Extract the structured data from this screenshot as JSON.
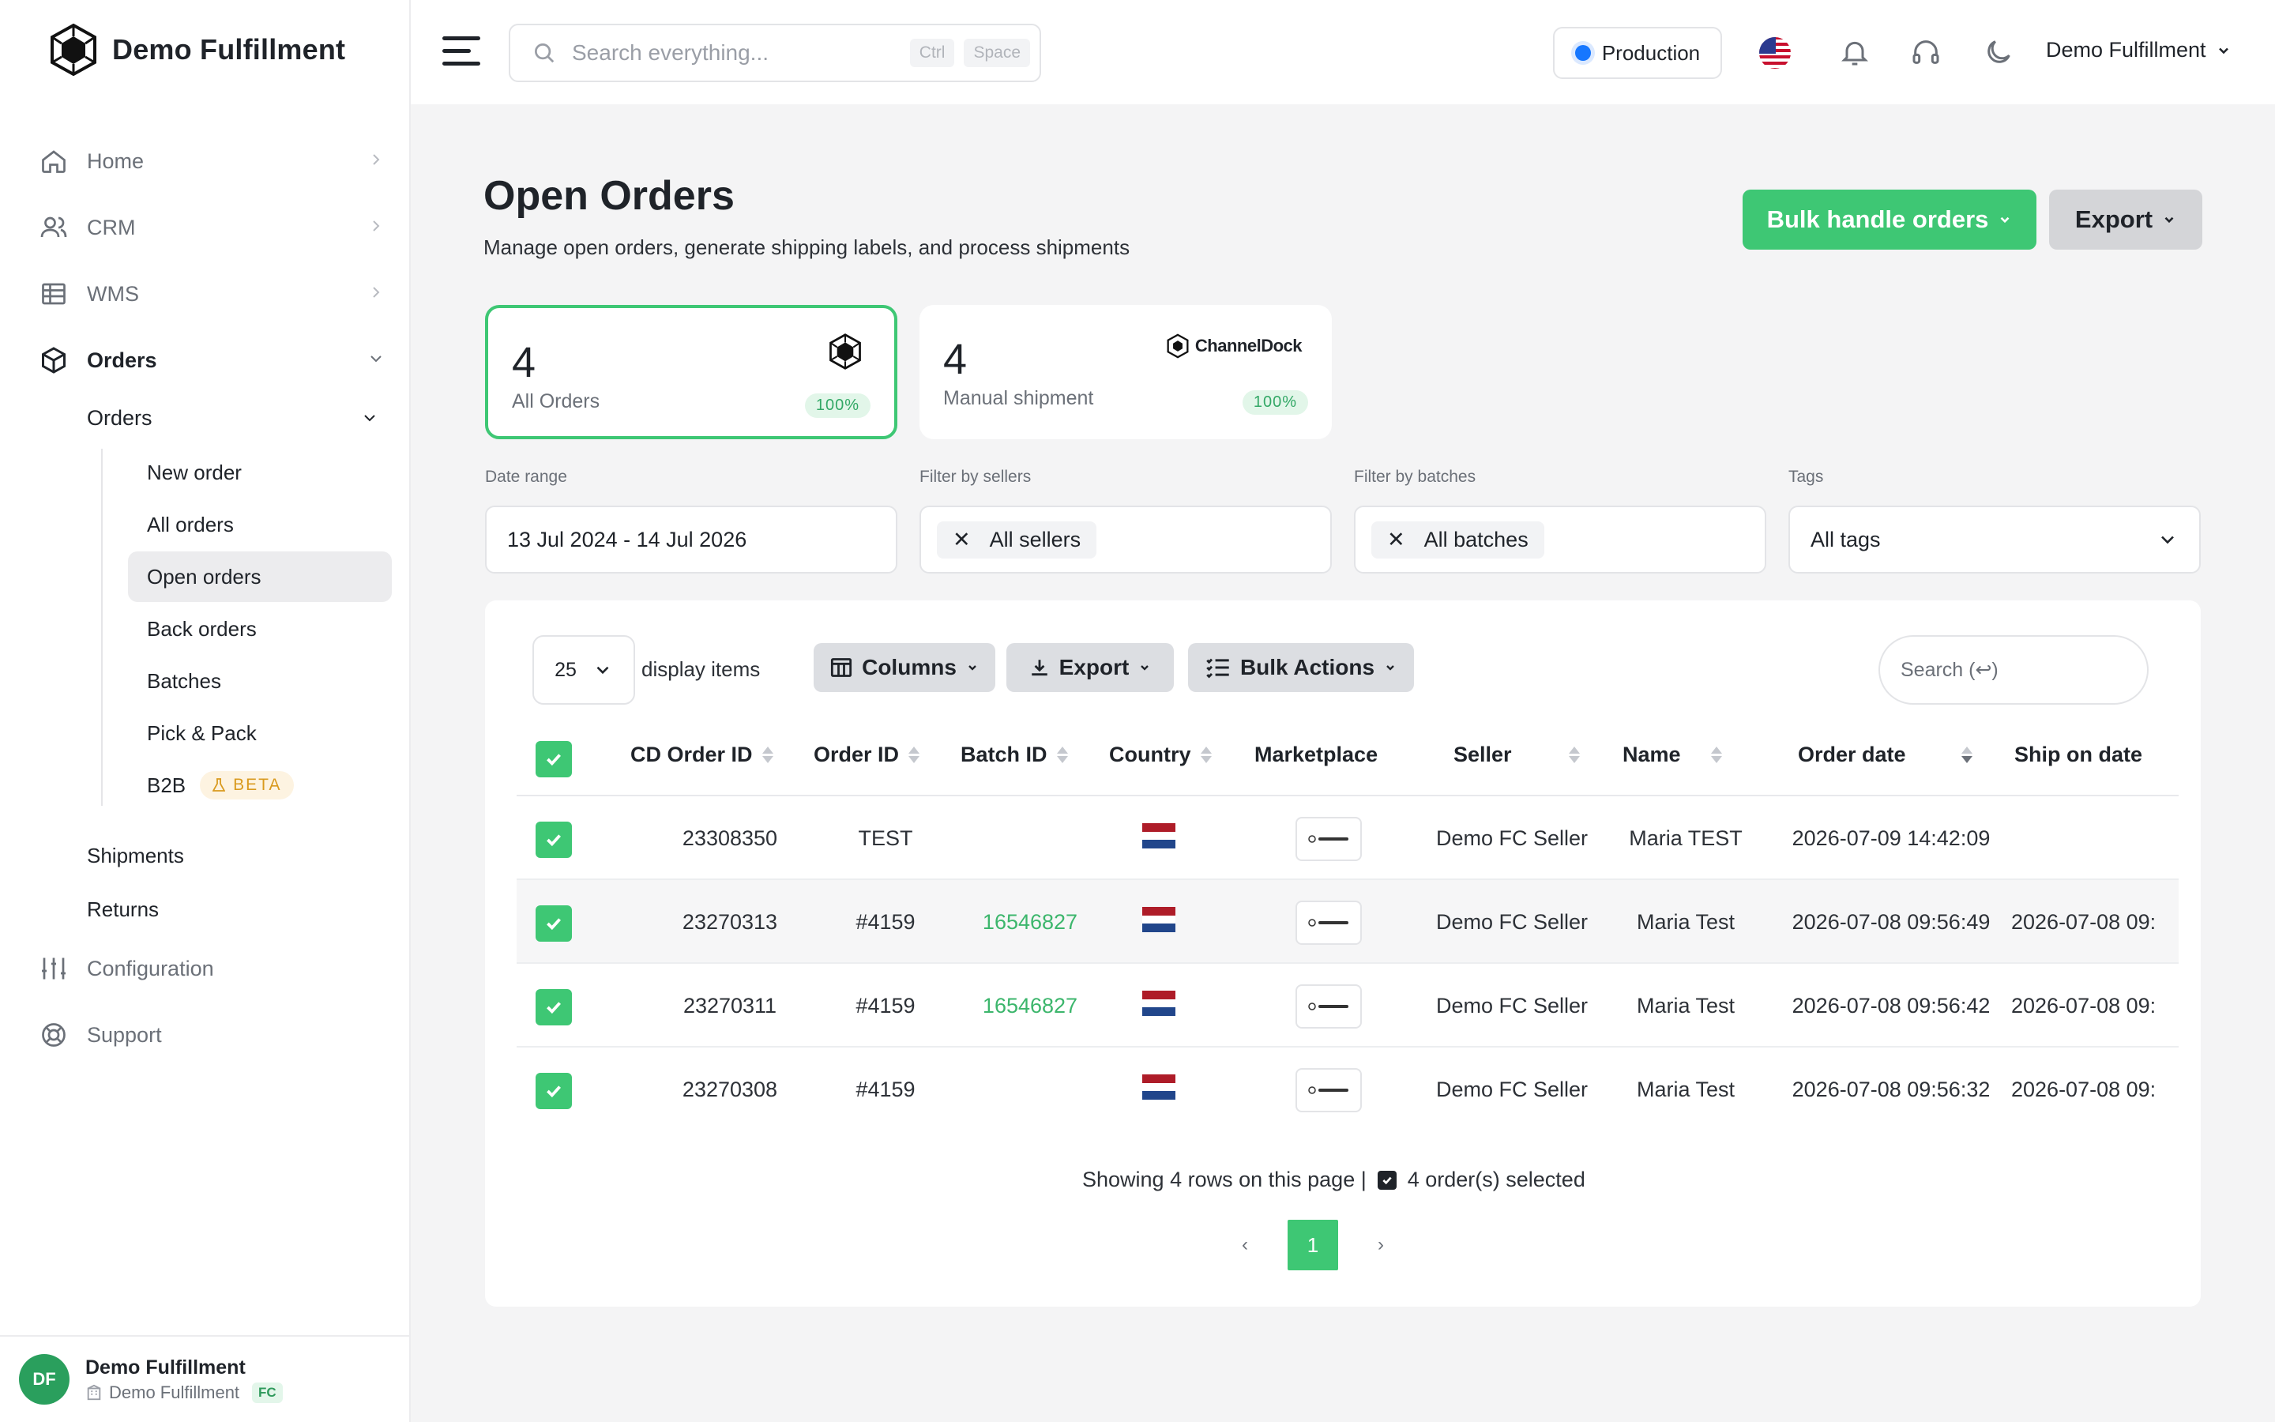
{
  "brand": {
    "name": "Demo Fulfillment"
  },
  "sidebar": {
    "items": [
      {
        "label": "Home",
        "icon": "home-icon"
      },
      {
        "label": "CRM",
        "icon": "users-icon"
      },
      {
        "label": "WMS",
        "icon": "table-icon"
      },
      {
        "label": "Orders",
        "icon": "box-icon"
      }
    ],
    "orders_sub": {
      "label": "Orders"
    },
    "orders_leaves": [
      "New order",
      "All orders",
      "Open orders",
      "Back orders",
      "Batches",
      "Pick & Pack",
      "B2B"
    ],
    "beta_label": "BETA",
    "shipments": "Shipments",
    "returns": "Returns",
    "configuration": "Configuration",
    "support": "Support",
    "footer": {
      "initials": "DF",
      "name": "Demo Fulfillment",
      "sub": "Demo Fulfillment",
      "badge": "FC"
    }
  },
  "topbar": {
    "search_placeholder": "Search everything...",
    "kbd1": "Ctrl",
    "kbd2": "Space",
    "environment": "Production",
    "user": "Demo Fulfillment"
  },
  "page": {
    "title": "Open Orders",
    "subtitle": "Manage open orders, generate shipping labels, and process shipments",
    "bulk_button": "Bulk handle orders",
    "export_button": "Export"
  },
  "cards": [
    {
      "count": "4",
      "label": "All Orders",
      "pct": "100%"
    },
    {
      "count": "4",
      "label": "Manual shipment",
      "pct": "100%",
      "brand": "ChannelDock"
    }
  ],
  "filters": {
    "date_label": "Date range",
    "date_value": "13 Jul 2024 - 14 Jul 2026",
    "sellers_label": "Filter by sellers",
    "sellers_value": "All sellers",
    "batches_label": "Filter by batches",
    "batches_value": "All batches",
    "tags_label": "Tags",
    "tags_value": "All tags"
  },
  "table_toolbar": {
    "per_page": "25",
    "per_page_label": "display items",
    "columns": "Columns",
    "export": "Export",
    "bulk_actions": "Bulk Actions",
    "search_placeholder": "Search (↩)"
  },
  "table": {
    "headers": [
      "CD Order ID",
      "Order ID",
      "Batch ID",
      "Country",
      "Marketplace",
      "Seller",
      "Name",
      "Order date",
      "Ship on date"
    ],
    "rows": [
      {
        "cd_id": "23308350",
        "order_id": "TEST",
        "batch": "",
        "seller": "Demo FC Seller",
        "name": "Maria TEST",
        "order_date": "2026-07-09 14:42:09",
        "ship_date": ""
      },
      {
        "cd_id": "23270313",
        "order_id": "#4159",
        "batch": "16546827",
        "seller": "Demo FC Seller",
        "name": "Maria Test",
        "order_date": "2026-07-08 09:56:49",
        "ship_date": "2026-07-08 09:"
      },
      {
        "cd_id": "23270311",
        "order_id": "#4159",
        "batch": "16546827",
        "seller": "Demo FC Seller",
        "name": "Maria Test",
        "order_date": "2026-07-08 09:56:42",
        "ship_date": "2026-07-08 09:"
      },
      {
        "cd_id": "23270308",
        "order_id": "#4159",
        "batch": "",
        "seller": "Demo FC Seller",
        "name": "Maria Test",
        "order_date": "2026-07-08 09:56:32",
        "ship_date": "2026-07-08 09:"
      }
    ],
    "summary_rows": "Showing 4 rows on this page |",
    "summary_selected": "4 order(s) selected",
    "current_page": "1"
  },
  "colors": {
    "accent": "#3ec774",
    "link": "#3cb66c",
    "env_dot": "#1677ff"
  }
}
